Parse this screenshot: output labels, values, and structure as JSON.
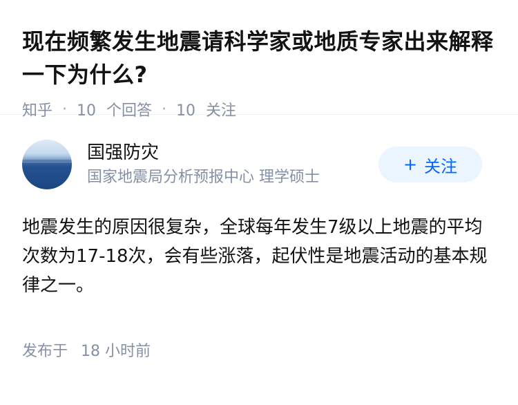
{
  "question": {
    "title": "现在频繁发生地震请科学家或地质专家出来解释一下为什么?",
    "source": "知乎",
    "separator": "·",
    "answers_count": "10",
    "answers_label": "个回答",
    "followers_count": "10",
    "followers_label": "关注"
  },
  "answer": {
    "author": {
      "name": "国强防灾",
      "bio": "国家地震局分析预报中心 理学硕士",
      "avatar_icon": "ocean-horizon-avatar"
    },
    "follow_button": {
      "icon": "+",
      "label": "关注"
    },
    "content": "地震发生的原因很复杂，全球每年发生7级以上地震的平均次数为17-18次，会有些涨落，起伏性是地震活动的基本规律之一。",
    "published_label": "发布于",
    "published_time": "18 小时前"
  },
  "colors": {
    "accent": "#0066ff",
    "follow_bg": "#ebf5ff",
    "meta": "#8590a6",
    "text": "#121212"
  }
}
